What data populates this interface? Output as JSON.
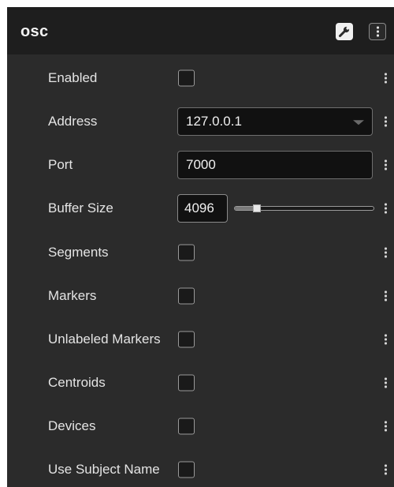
{
  "panel": {
    "title": "osc",
    "header_buttons": [
      {
        "icon": "wrench-icon"
      },
      {
        "icon": "more-vertical-icon"
      }
    ]
  },
  "rows": {
    "enabled": {
      "label": "Enabled",
      "checked": false
    },
    "address": {
      "label": "Address",
      "value": "127.0.0.1"
    },
    "port": {
      "label": "Port",
      "value": "7000"
    },
    "buffer_size": {
      "label": "Buffer Size",
      "value": "4096",
      "slider_fraction": 0.16
    },
    "segments": {
      "label": "Segments",
      "checked": false
    },
    "markers": {
      "label": "Markers",
      "checked": false
    },
    "unlabeled_markers": {
      "label": "Unlabeled Markers",
      "checked": false
    },
    "centroids": {
      "label": "Centroids",
      "checked": false
    },
    "devices": {
      "label": "Devices",
      "checked": false
    },
    "use_subject_name": {
      "label": "Use Subject Name",
      "checked": false
    }
  },
  "colors": {
    "panel_bg": "#2b2b2b",
    "header_bg": "#1e1e1e",
    "text": "#e4e4e4",
    "input_bg": "#111111",
    "border": "#6e6e6e"
  }
}
